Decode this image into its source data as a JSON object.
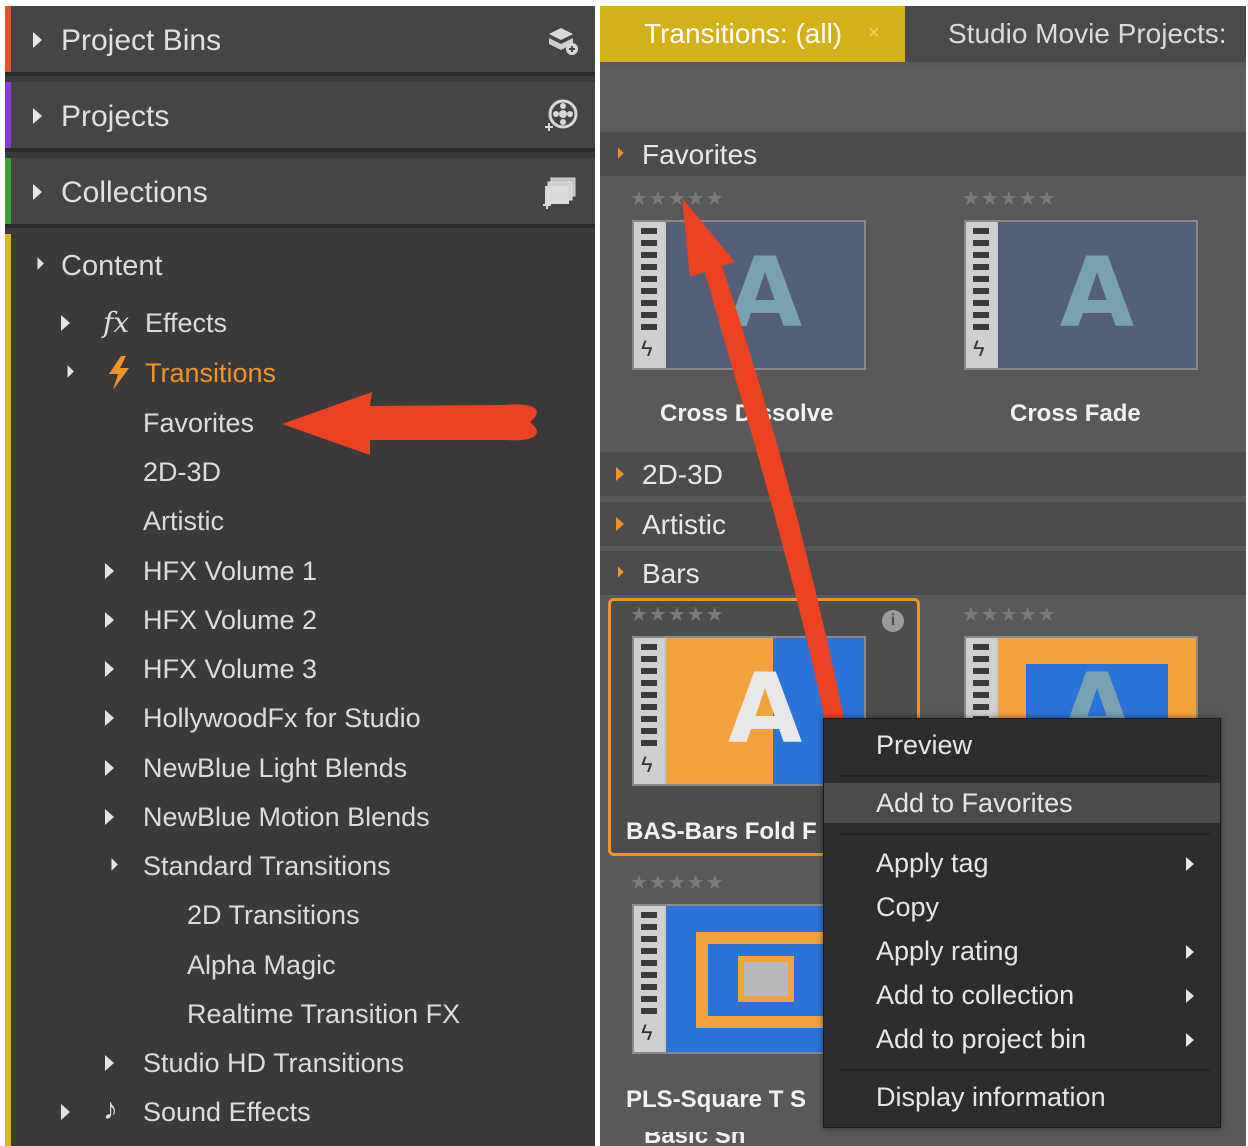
{
  "colors": {
    "accent_orange": "#f0922b",
    "tab_yellow": "#d4b01a",
    "annotation_red": "#ec4221",
    "project_bins_strip": "#e0542b",
    "projects_strip": "#8a3bd6",
    "collections_strip": "#3aa03a",
    "content_strip": "#d9b81f"
  },
  "left_panel": {
    "headers": [
      {
        "label": "Project Bins",
        "icon": "project-bins-icon"
      },
      {
        "label": "Projects",
        "icon": "projects-icon"
      },
      {
        "label": "Collections",
        "icon": "collections-icon"
      }
    ],
    "content": {
      "label": "Content",
      "effects_label": "Effects",
      "transitions_label": "Transitions",
      "favorites_label": "Favorites",
      "d2_3d_label": "2D-3D",
      "artistic_label": "Artistic",
      "hfx1_label": "HFX Volume 1",
      "hfx2_label": "HFX Volume 2",
      "hfx3_label": "HFX Volume 3",
      "hollywood_label": "HollywoodFx for Studio",
      "newblue_light_label": "NewBlue Light Blends",
      "newblue_motion_label": "NewBlue Motion Blends",
      "standard_label": "Standard Transitions",
      "std_2d_label": "2D Transitions",
      "alpha_magic_label": "Alpha Magic",
      "realtime_label": "Realtime Transition FX",
      "studio_hd_label": "Studio HD Transitions",
      "sound_effects_label": "Sound Effects"
    }
  },
  "right_panel": {
    "tabs": {
      "active": "Transitions: (all)",
      "close_glyph": "×",
      "other": "Studio Movie Projects:"
    },
    "sections": {
      "favorites": "Favorites",
      "d2_3d": "2D-3D",
      "artistic": "Artistic",
      "bars": "Bars"
    },
    "stars_glyph": "★★★★★",
    "info_glyph": "i",
    "thumb_letter": "A",
    "items": {
      "cross_dissolve": "Cross Dissolve",
      "cross_fade": "Cross Fade",
      "bars_fold": "BAS-Bars Fold F",
      "square": "PLS-Square T S",
      "partial": "Basic Sh"
    }
  },
  "context_menu": {
    "preview": "Preview",
    "add_to_favorites": "Add to Favorites",
    "apply_tag": "Apply tag",
    "copy": "Copy",
    "apply_rating": "Apply rating",
    "add_to_collection": "Add to collection",
    "add_to_project_bin": "Add to project bin",
    "display_information": "Display information"
  }
}
